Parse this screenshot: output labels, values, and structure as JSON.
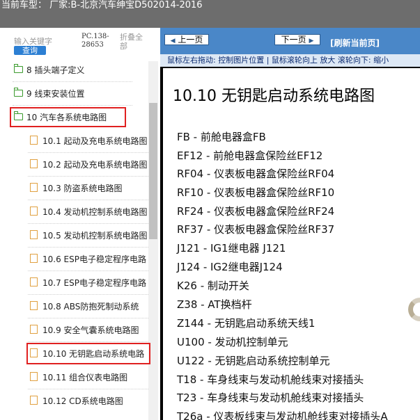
{
  "title_bar": {
    "text": "当前车型：  厂家:B-北京汽车绅宝D502014-2016"
  },
  "sidebar": {
    "search_placeholder": "输入关键字",
    "search_button": "查询",
    "pc_code": "PC.138-28653",
    "collapse_all": "折叠全部",
    "items": [
      {
        "label": "8  插头端子定义",
        "type": "folder"
      },
      {
        "label": "9  线束安装位置",
        "type": "folder"
      },
      {
        "label": "10  汽车各系统电路图",
        "type": "folder-open"
      },
      {
        "label": "10.1  起动及充电系统电路图",
        "type": "doc"
      },
      {
        "label": "10.2  起动及充电系统电路图",
        "type": "doc"
      },
      {
        "label": "10.3  防盗系统电路图",
        "type": "doc"
      },
      {
        "label": "10.4  发动机控制系统电路图",
        "type": "doc"
      },
      {
        "label": "10.5  发动机控制系统电路图",
        "type": "doc"
      },
      {
        "label": "10.6  ESP电子稳定程序电路",
        "type": "doc"
      },
      {
        "label": "10.7  ESP电子稳定程序电路",
        "type": "doc"
      },
      {
        "label": "10.8  ABS防抱死制动系统",
        "type": "doc"
      },
      {
        "label": "10.9  安全气囊系统电路图",
        "type": "doc"
      },
      {
        "label": "10.10  无钥匙启动系统电路",
        "type": "doc"
      },
      {
        "label": "10.11  组合仪表电路图",
        "type": "doc"
      },
      {
        "label": "10.12  CD系统电路图",
        "type": "doc"
      }
    ]
  },
  "viewer": {
    "prev_button": "上一页",
    "next_button": "下一页",
    "refresh": "[刷新当前页]",
    "hint": "鼠标左右拖动: 控制图片位置 | 鼠标滚轮向上 放大  滚轮向下: 缩小",
    "page_title": "10.10  无钥匙启动系统电路图",
    "entries": [
      "FB -  前舱电器盒FB",
      "EF12 -  前舱电器盒保险丝EF12",
      "RF04 -  仪表板电器盒保险丝RF04",
      "RF10 -  仪表板电器盒保险丝RF10",
      "RF24 -  仪表板电器盒保险丝RF24",
      "RF37 -  仪表板电器盒保险丝RF37",
      "J121 -  IG1继电器 J121",
      "J124 -  IG2继电器J124",
      "K26 -  制动开关",
      "Z38 -  AT换档杆",
      "Z144 -  无钥匙启动系统天线1",
      "U100 -  发动机控制单元",
      "U122 -  无钥匙启动系统控制单元",
      "T18 -  车身线束与发动机舱线束对接插头",
      "T23 -  车身线束与发动机舱线束对接插头",
      "T26a -  仪表板线束与发动机舱线束对接插头A"
    ]
  },
  "colors": {
    "toolbar": "#4a87c8",
    "highlight": "#e02020",
    "titlebar": "#6d6d6d"
  }
}
